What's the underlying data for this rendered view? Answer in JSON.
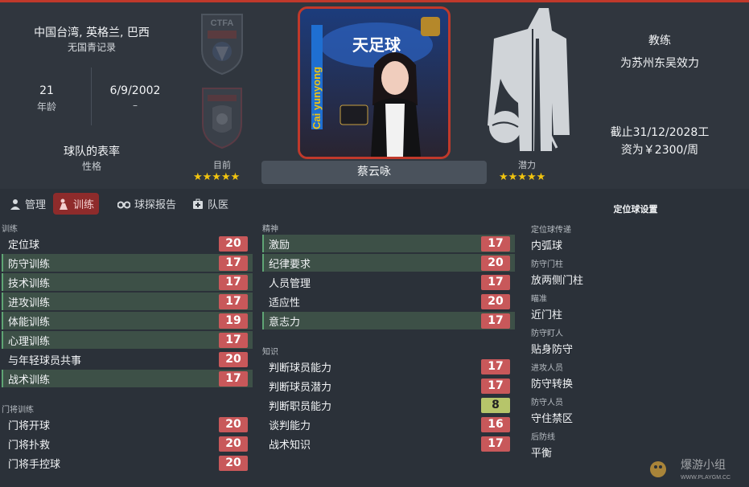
{
  "profile": {
    "nationality": "中国台湾, 英格兰, 巴西",
    "youth_record": "无国青记录",
    "age_value": "21",
    "age_label": "年龄",
    "birth_value": "6/9/2002",
    "birth_label": "–",
    "team_rating": "球队的表率",
    "personality": "性格",
    "current_label": "目前",
    "potential_label": "潜力",
    "current_stars": "★★★★★",
    "potential_stars": "★★★★★",
    "name": "蔡云咏",
    "role": "教练",
    "club": "为苏州东吴效力",
    "contract_line1": "截止31/12/2028工",
    "contract_line2": "资为￥2300/周"
  },
  "photo": {
    "banner_text": "Cai yunyong",
    "logo_text": "天足球"
  },
  "tabs": [
    {
      "label": "管理",
      "icon": "manage-icon"
    },
    {
      "label": "训练",
      "icon": "training-icon"
    },
    {
      "label": "球探报告",
      "icon": "binoculars-icon"
    },
    {
      "label": "队医",
      "icon": "medical-icon"
    }
  ],
  "training": {
    "title": "训练",
    "rows": [
      {
        "label": "定位球",
        "value": "20"
      },
      {
        "label": "防守训练",
        "value": "17"
      },
      {
        "label": "技术训练",
        "value": "17"
      },
      {
        "label": "进攻训练",
        "value": "17"
      },
      {
        "label": "体能训练",
        "value": "19"
      },
      {
        "label": "心理训练",
        "value": "17"
      },
      {
        "label": "与年轻球员共事",
        "value": "20"
      },
      {
        "label": "战术训练",
        "value": "17"
      }
    ]
  },
  "goalkeeping": {
    "title": "门将训练",
    "rows": [
      {
        "label": "门将开球",
        "value": "20"
      },
      {
        "label": "门将扑救",
        "value": "20"
      },
      {
        "label": "门将手控球",
        "value": "20"
      }
    ]
  },
  "mental": {
    "title": "精神",
    "rows": [
      {
        "label": "激励",
        "value": "17"
      },
      {
        "label": "纪律要求",
        "value": "20"
      },
      {
        "label": "人员管理",
        "value": "17"
      },
      {
        "label": "适应性",
        "value": "20"
      },
      {
        "label": "意志力",
        "value": "17"
      }
    ]
  },
  "knowledge": {
    "title": "知识",
    "rows": [
      {
        "label": "判断球员能力",
        "value": "17"
      },
      {
        "label": "判断球员潜力",
        "value": "17"
      },
      {
        "label": "判断职员能力",
        "value": "8"
      },
      {
        "label": "谈判能力",
        "value": "16"
      },
      {
        "label": "战术知识",
        "value": "17"
      }
    ]
  },
  "set_pieces": {
    "title": "定位球设置",
    "items": [
      {
        "label": "定位球传递",
        "value": "内弧球"
      },
      {
        "label": "防守门柱",
        "value": "放两侧门柱"
      },
      {
        "label": "瞄准",
        "value": "近门柱"
      },
      {
        "label": "防守盯人",
        "value": "贴身防守"
      },
      {
        "label": "进攻人员",
        "value": "防守转换"
      },
      {
        "label": "防守人员",
        "value": "守住禁区"
      },
      {
        "label": "后防线",
        "value": "平衡"
      }
    ]
  },
  "watermark": {
    "text": "爆游小组",
    "url": "WWW.PLAYGM.CC"
  },
  "colors": {
    "accent": "#c0392b",
    "value_red": "#c8585a",
    "value_yellow": "#b6c56a",
    "highlight_row": "#3d5047",
    "star": "#f1c40f"
  }
}
